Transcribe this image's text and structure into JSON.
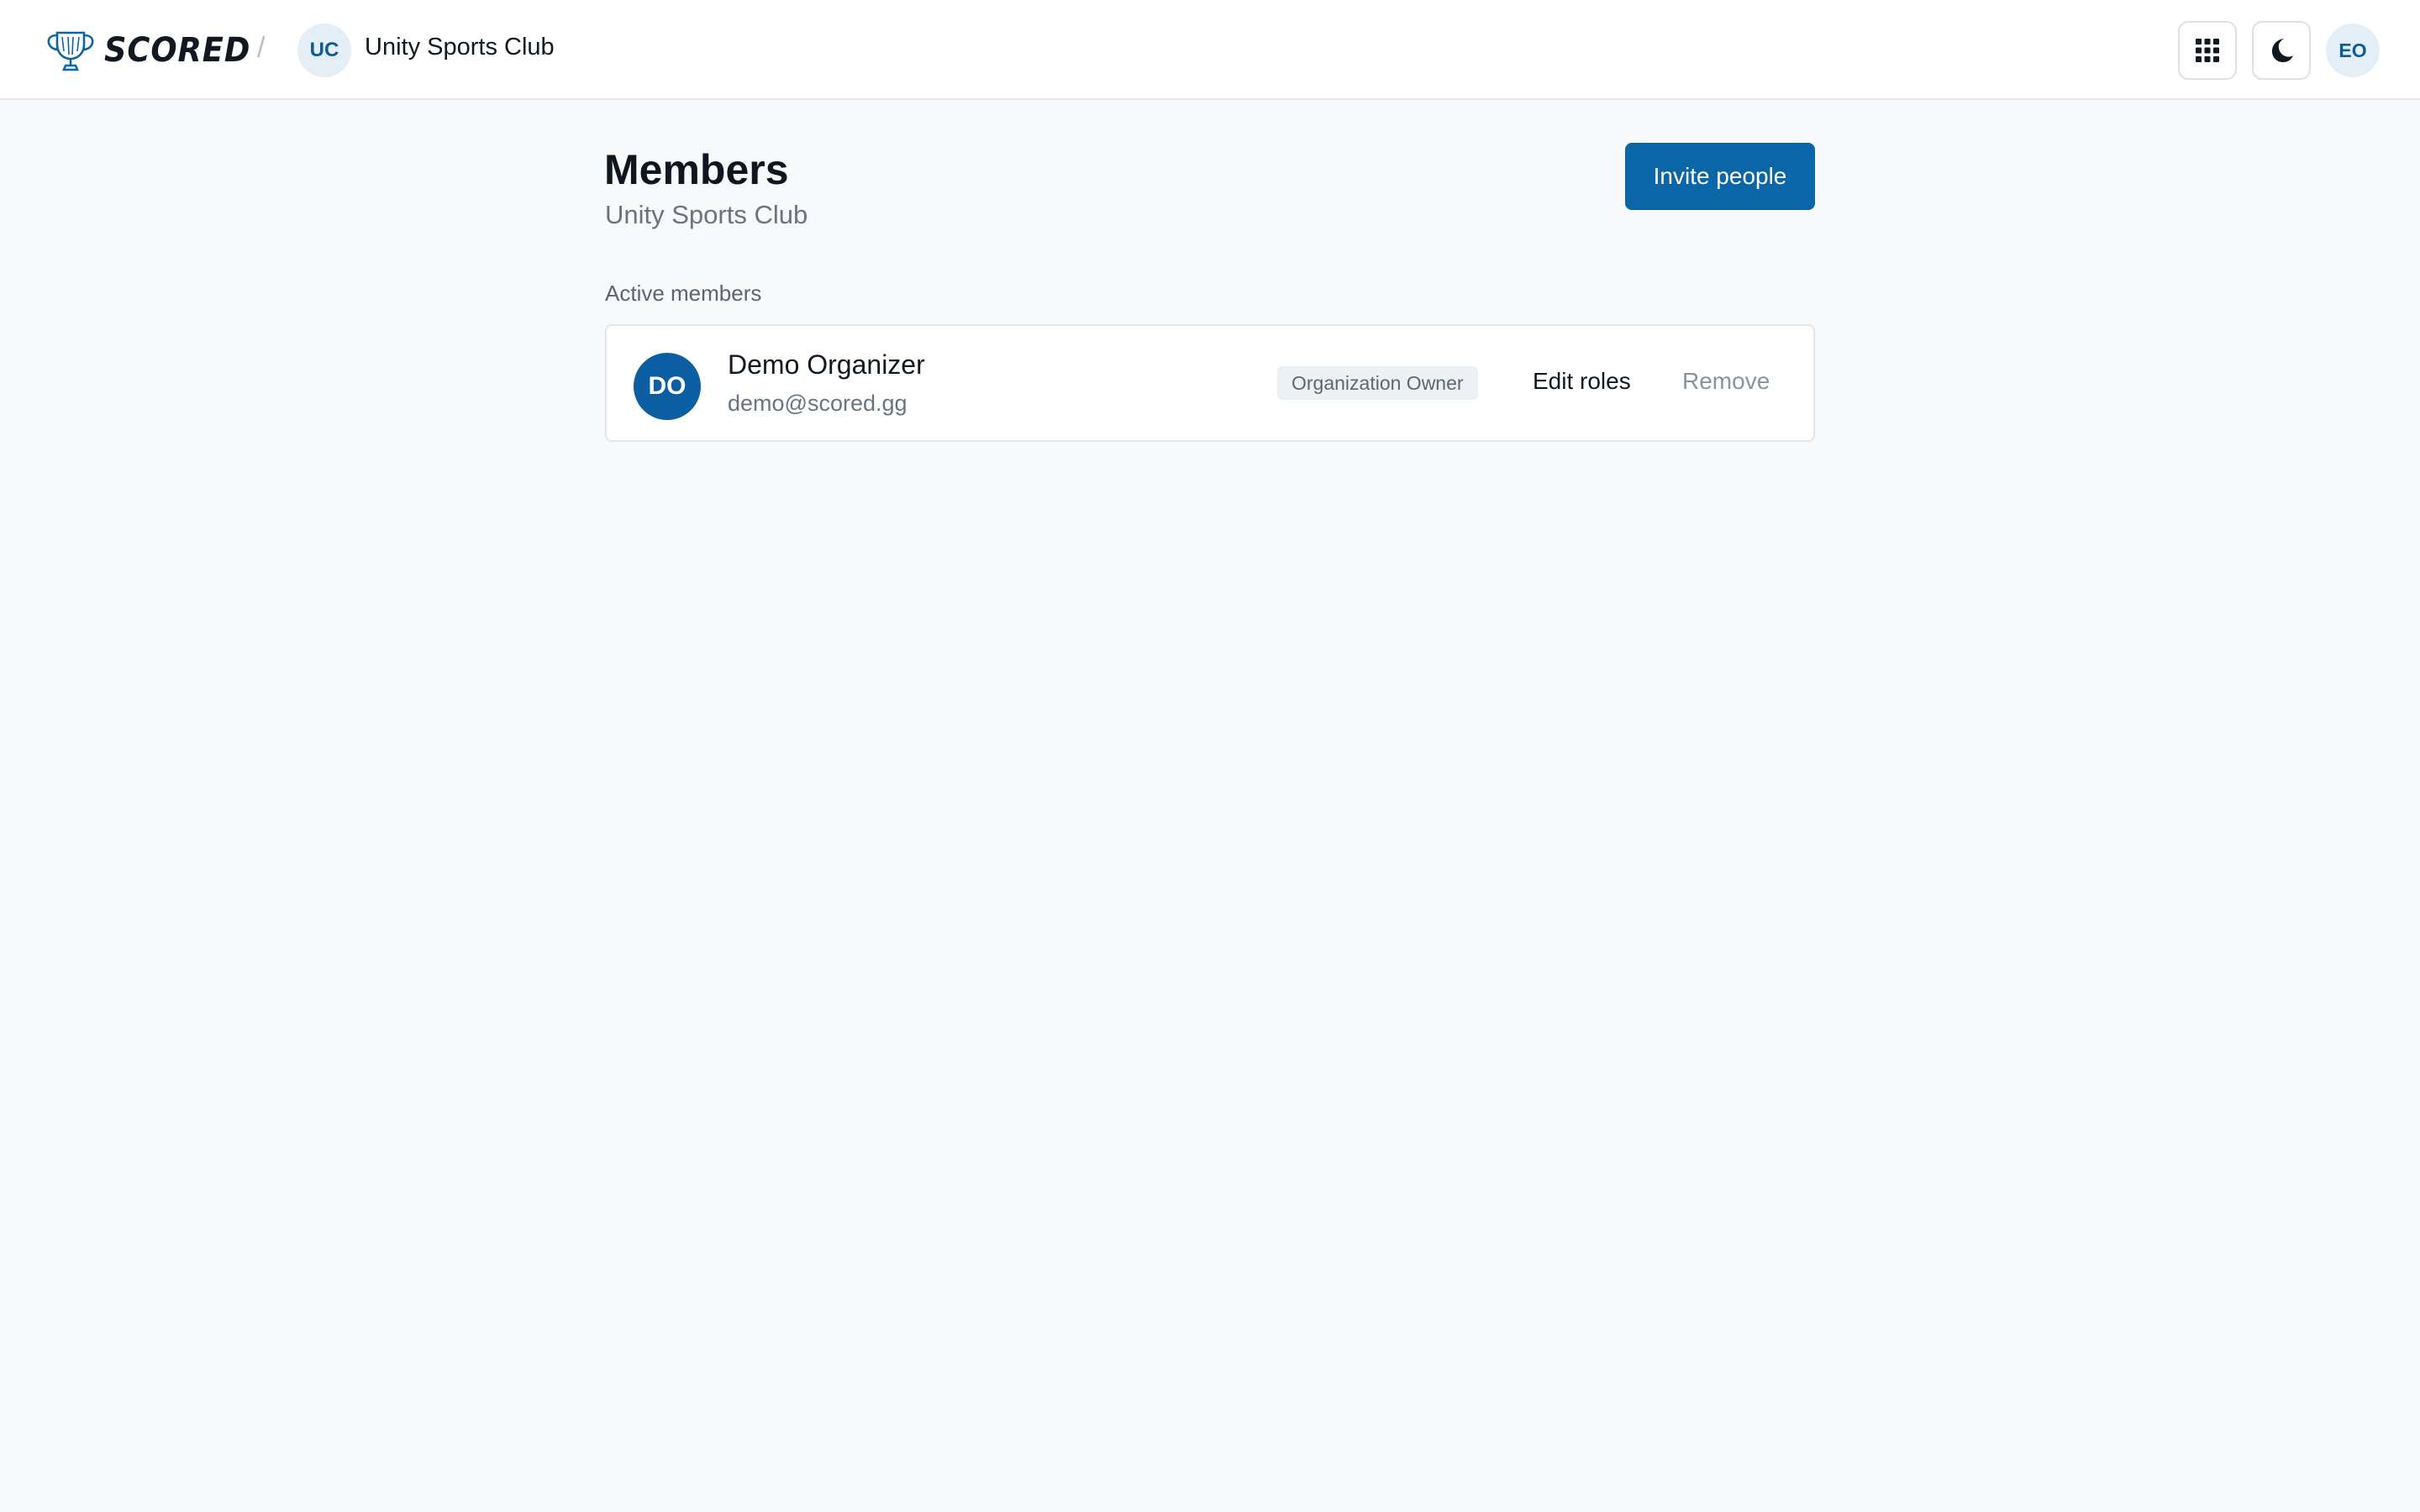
{
  "header": {
    "brand": "SCORED",
    "breadcrumb_separator": "/",
    "org_initials": "UC",
    "org_name": "Unity Sports Club",
    "apps_icon": "grid-icon",
    "theme_icon": "moon-icon",
    "user_initials": "EO"
  },
  "main": {
    "title": "Members",
    "subtitle": "Unity Sports Club",
    "invite_label": "Invite people",
    "section_label": "Active members",
    "members": [
      {
        "initials": "DO",
        "name": "Demo Organizer",
        "email": "demo@scored.gg",
        "role": "Organization Owner",
        "edit_label": "Edit roles",
        "remove_label": "Remove"
      }
    ]
  },
  "colors": {
    "accent": "#0b66a8",
    "avatar_bg": "#0a5ea1",
    "page_bg": "#f7f9fb"
  }
}
